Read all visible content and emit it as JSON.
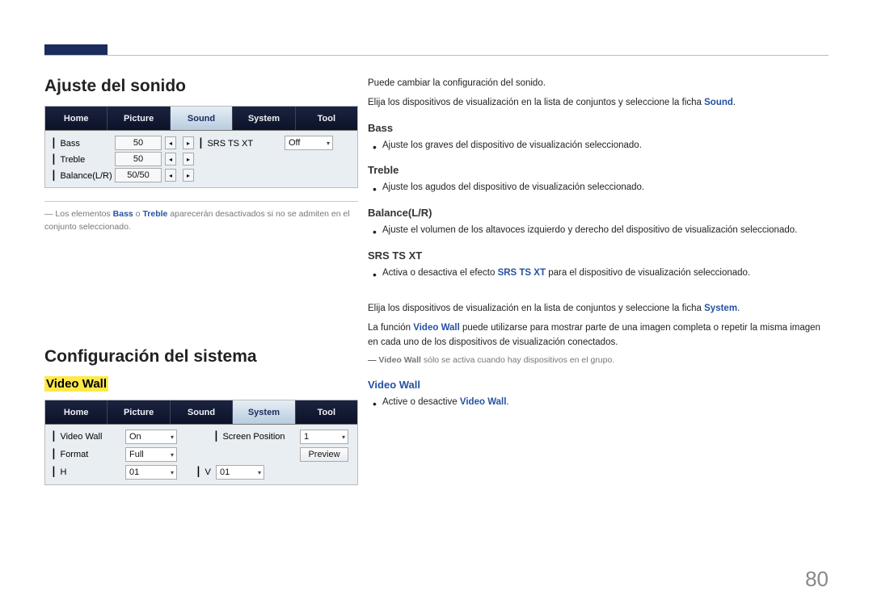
{
  "page_number": "80",
  "left": {
    "section1_title": "Ajuste del sonido",
    "section2_title": "Configuración del sistema",
    "video_wall_heading": "Video Wall",
    "sound_panel": {
      "tabs": [
        "Home",
        "Picture",
        "Sound",
        "System",
        "Tool"
      ],
      "active_index": 2,
      "rows": {
        "bass": {
          "label": "Bass",
          "value": "50",
          "srs_label": "SRS TS XT",
          "srs_value": "Off"
        },
        "treble": {
          "label": "Treble",
          "value": "50"
        },
        "balance": {
          "label": "Balance(L/R)",
          "value": "50/50"
        }
      }
    },
    "system_panel": {
      "tabs": [
        "Home",
        "Picture",
        "Sound",
        "System",
        "Tool"
      ],
      "active_index": 3,
      "rows": {
        "videowall": {
          "label": "Video Wall",
          "value": "On",
          "sp_label": "Screen Position",
          "sp_value": "1"
        },
        "format": {
          "label": "Format",
          "value": "Full",
          "preview_btn": "Preview"
        },
        "h": {
          "label": "H",
          "value": "01",
          "v_label": "V",
          "v_value": "01"
        }
      }
    },
    "footnote_prefix": "― Los elementos ",
    "footnote_bass": "Bass",
    "footnote_or": " o ",
    "footnote_treble": "Treble",
    "footnote_suffix": " aparecerán desactivados si no se admiten en el conjunto seleccionado."
  },
  "right": {
    "intro1": "Puede cambiar la configuración del sonido.",
    "intro2a": "Elija los dispositivos de visualización en la lista de conjuntos y seleccione la ficha ",
    "intro2b": "Sound",
    "intro2c": ".",
    "bass_h": "Bass",
    "bass_li": "Ajuste los graves del dispositivo de visualización seleccionado.",
    "treble_h": "Treble",
    "treble_li": "Ajuste los agudos del dispositivo de visualización seleccionado.",
    "balance_h": "Balance(L/R)",
    "balance_li": "Ajuste el volumen de los altavoces izquierdo y derecho del dispositivo de visualización seleccionado.",
    "srs_h": "SRS TS XT",
    "srs_li_a": "Activa o desactiva el efecto ",
    "srs_li_b": "SRS TS XT",
    "srs_li_c": " para el dispositivo de visualización seleccionado.",
    "sys_intro_a": "Elija los dispositivos de visualización en la lista de conjuntos y seleccione la ficha ",
    "sys_intro_b": "System",
    "sys_intro_c": ".",
    "sys_desc_a": "La función ",
    "sys_desc_b": "Video Wall",
    "sys_desc_c": " puede utilizarse para mostrar parte de una imagen completa o repetir la misma imagen en cada uno de los dispositivos de visualización conectados.",
    "sys_note_a": "― ",
    "sys_note_b": "Video Wall",
    "sys_note_c": " sólo se activa cuando hay dispositivos en el grupo.",
    "vw_h": "Video Wall",
    "vw_li_a": "Active o desactive ",
    "vw_li_b": "Video Wall",
    "vw_li_c": "."
  }
}
